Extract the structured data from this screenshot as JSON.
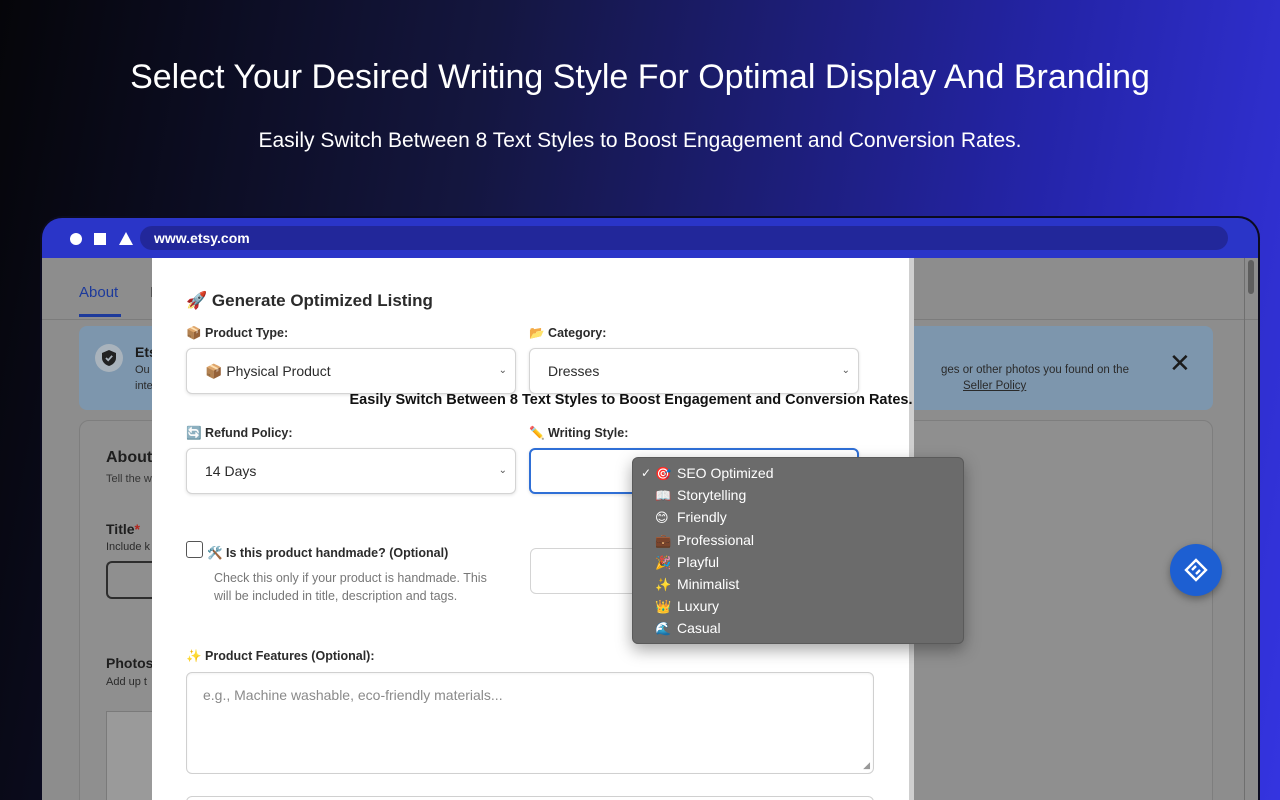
{
  "hero": {
    "title": "Select Your Desired Writing Style For Optimal Display And Branding",
    "subtitle": "Easily Switch Between 8 Text Styles to Boost Engagement and Conversion Rates."
  },
  "browser": {
    "url": "www.etsy.com"
  },
  "etsy": {
    "tab_active": "About",
    "tab_next_partial": "I",
    "notice": {
      "title_partial": "Ets",
      "frag1": "Ou",
      "frag2": "inte",
      "right_text": "ges or other photos you found on the",
      "right_link": "Seller Policy"
    },
    "about": {
      "title_partial": "About",
      "subtitle_partial": "Tell the w",
      "title_label": "Title",
      "title_required": "*",
      "title_help_partial": "Include k",
      "photos_label": "Photos",
      "photos_help_partial": "Add up t"
    }
  },
  "modal": {
    "title": "🚀 Generate Optimized Listing",
    "product_type": {
      "label": "📦 Product Type:",
      "value": "📦 Physical Product"
    },
    "category": {
      "label": "📂 Category:",
      "value": "Dresses"
    },
    "overlay_caption": "Easily Switch Between 8 Text Styles to Boost Engagement and Conversion Rates.",
    "refund_policy": {
      "label": "🔄 Refund Policy:",
      "value": "14 Days"
    },
    "writing_style": {
      "label": "✏️ Writing Style:",
      "selected": "SEO Optimized",
      "options": [
        {
          "icon": "🎯",
          "label": "SEO Optimized"
        },
        {
          "icon": "📖",
          "label": "Storytelling"
        },
        {
          "icon": "😊",
          "label": "Friendly"
        },
        {
          "icon": "💼",
          "label": "Professional"
        },
        {
          "icon": "🎉",
          "label": "Playful"
        },
        {
          "icon": "✨",
          "label": "Minimalist"
        },
        {
          "icon": "👑",
          "label": "Luxury"
        },
        {
          "icon": "🌊",
          "label": "Casual"
        }
      ]
    },
    "handmade": {
      "label": "🛠️ Is this product handmade? (Optional)",
      "help_line1": "Check this only if your product is handmade. This",
      "help_line2": "will be included in title, description and tags."
    },
    "features": {
      "label": "✨ Product Features (Optional):",
      "placeholder": "e.g., Machine washable, eco-friendly materials..."
    }
  },
  "colors": {
    "accent": "#2f6fd6",
    "etsy_blue": "#1d3a9b",
    "dropdown_bg": "#6b6b6b",
    "browser_bar": "#2a35c8"
  }
}
